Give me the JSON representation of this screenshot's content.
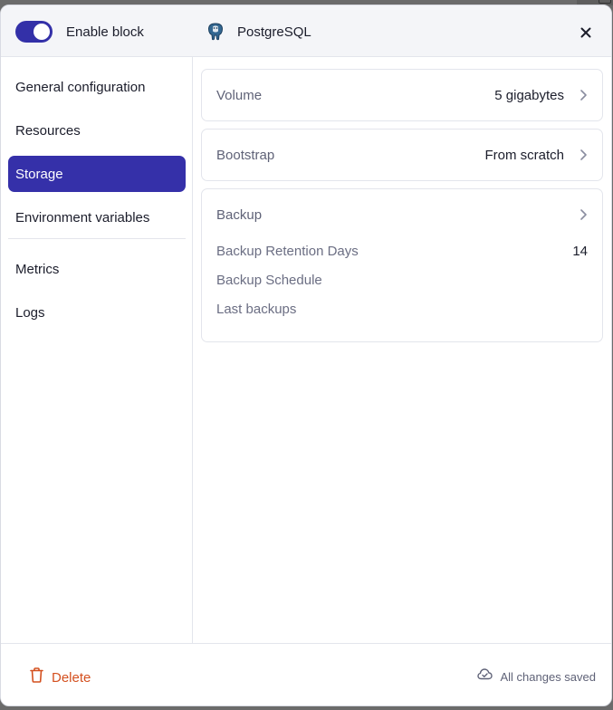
{
  "header": {
    "toggle_label": "Enable block",
    "toggle_on": true,
    "db_title": "PostgreSQL"
  },
  "sidebar": {
    "items": [
      {
        "label": "General configuration"
      },
      {
        "label": "Resources"
      },
      {
        "label": "Storage",
        "active": true
      },
      {
        "label": "Environment variables"
      },
      {
        "label": "Metrics"
      },
      {
        "label": "Logs"
      }
    ]
  },
  "main": {
    "volume": {
      "label": "Volume",
      "value": "5 gigabytes"
    },
    "bootstrap": {
      "label": "Bootstrap",
      "value": "From scratch"
    },
    "backup": {
      "label": "Backup",
      "retention_label": "Backup Retention Days",
      "retention_value": "14",
      "schedule_label": "Backup Schedule",
      "last_backups_label": "Last backups"
    }
  },
  "footer": {
    "delete_label": "Delete",
    "status": "All changes saved"
  },
  "colors": {
    "accent": "#3530a9",
    "danger": "#d4501f",
    "muted": "#5f6277"
  }
}
